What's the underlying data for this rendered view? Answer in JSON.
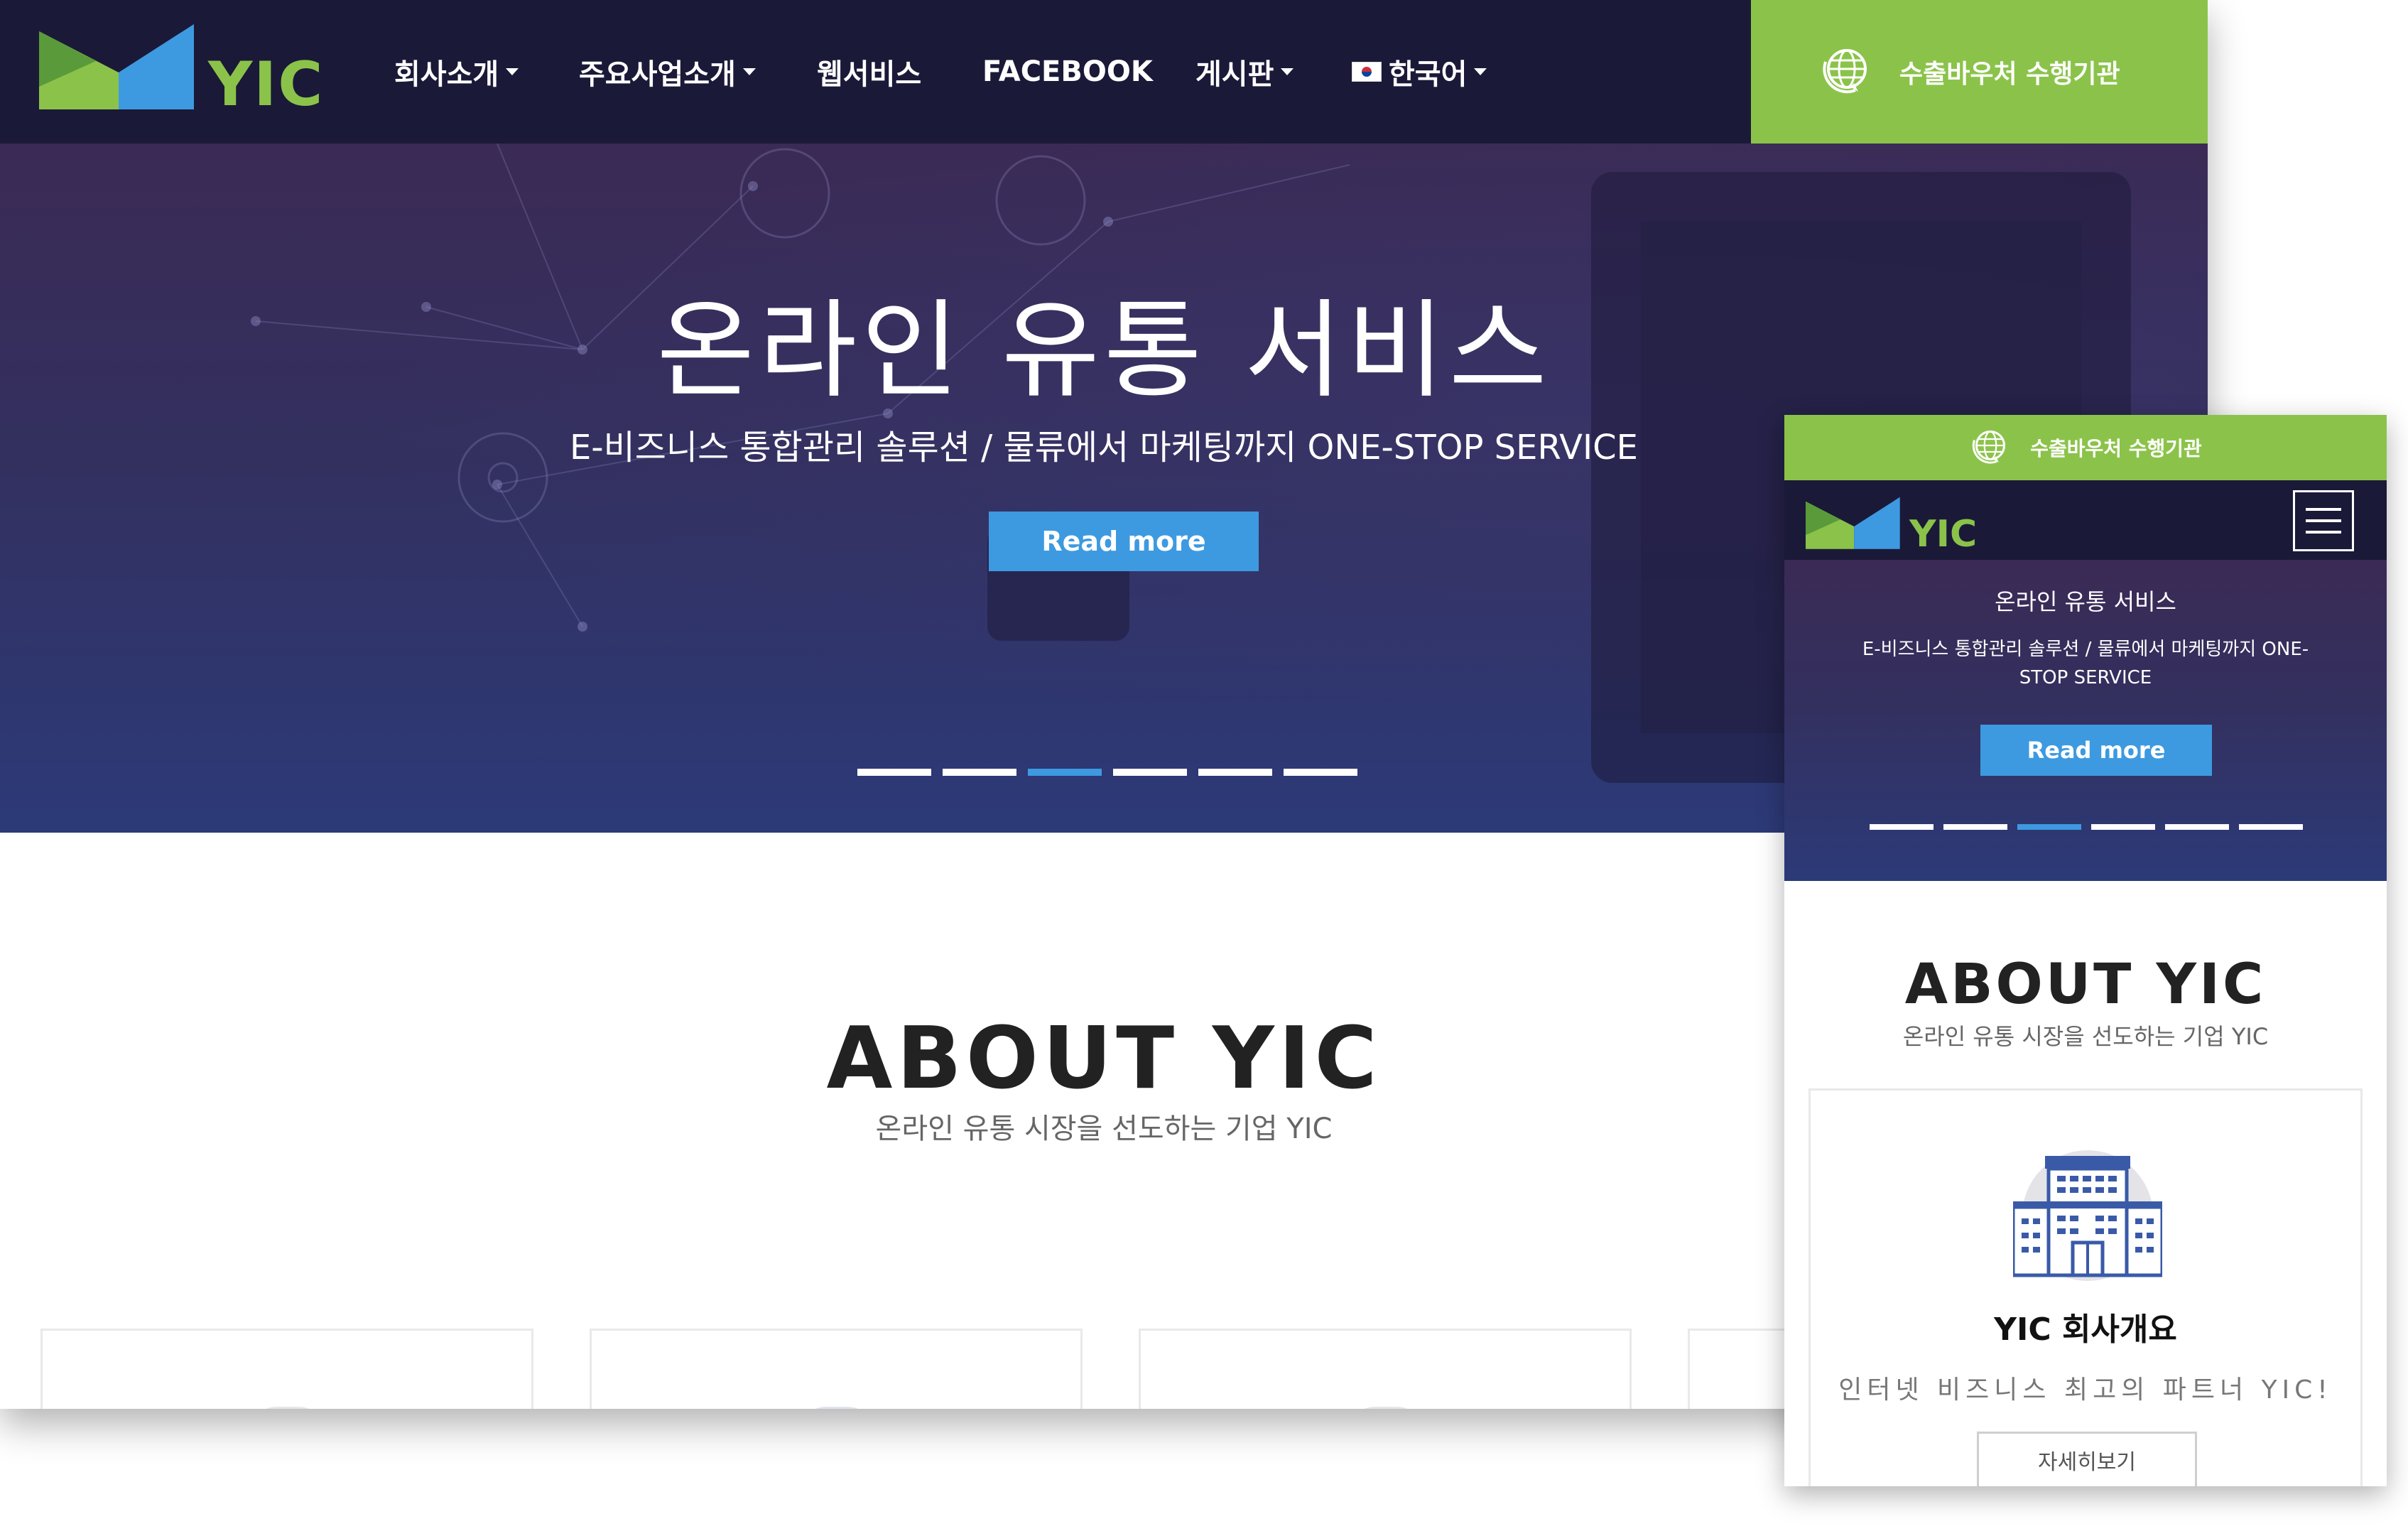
{
  "brand": {
    "logo_text": "YIC",
    "colors": {
      "green": "#8bc34a",
      "blue": "#3d9ae0",
      "navy": "#1b1938"
    }
  },
  "desktop": {
    "nav": {
      "items": [
        {
          "label": "회사소개",
          "has_dropdown": true
        },
        {
          "label": "주요사업소개",
          "has_dropdown": true
        },
        {
          "label": "웹서비스",
          "has_dropdown": false
        },
        {
          "label": "FACEBOOK",
          "has_dropdown": false
        },
        {
          "label": "게시판",
          "has_dropdown": true
        },
        {
          "label": "한국어",
          "has_dropdown": true,
          "icon": "korea-flag-icon"
        }
      ],
      "voucher_label": "수출바우처 수행기관",
      "voucher_icon": "globe-icon"
    },
    "hero": {
      "title": "온라인 유통 서비스",
      "subtitle": "E-비즈니스 통합관리 솔루션 / 물류에서 마케팅까지 ONE-STOP SERVICE",
      "button": "Read more",
      "slide_count": 6,
      "active_slide": 3
    },
    "about": {
      "title": "ABOUT YIC",
      "subtitle": "온라인 유통 시장을 선도하는 기업 YIC"
    }
  },
  "mobile": {
    "voucher_label": "수출바우처 수행기관",
    "hero": {
      "title": "온라인 유통 서비스",
      "subtitle": "E-비즈니스 통합관리 솔루션 / 물류에서 마케팅까지 ONE-STOP SERVICE",
      "button": "Read more",
      "slide_count": 6,
      "active_slide": 3
    },
    "about": {
      "title": "ABOUT YIC",
      "subtitle": "온라인 유통 시장을 선도하는 기업 YIC",
      "card": {
        "icon": "building-icon",
        "title": "YIC 회사개요",
        "description": "인터넷 비즈니스 최고의 파트너 YIC!",
        "button": "자세히보기"
      }
    }
  }
}
